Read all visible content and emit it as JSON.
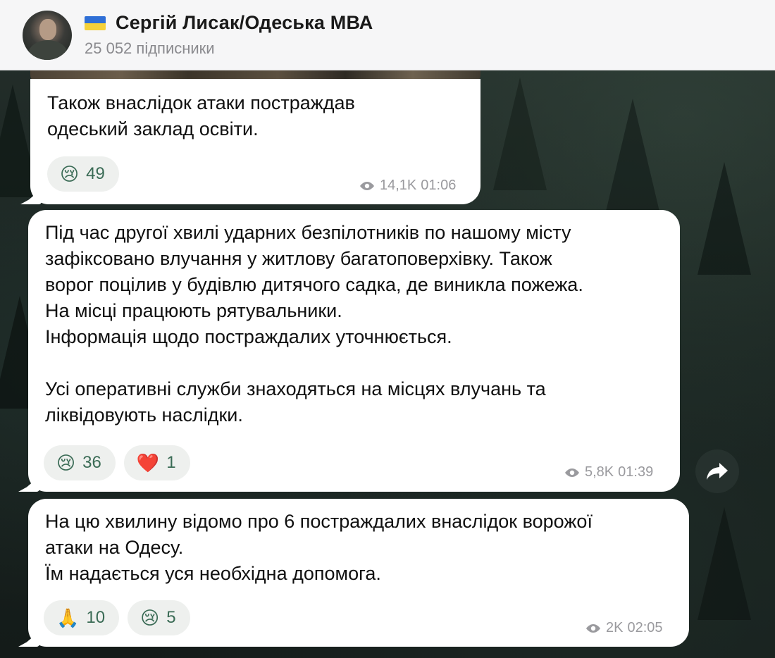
{
  "header": {
    "channel_name": "Сергій Лисак/Одеська МВА",
    "subscribers": "25 052 підписники"
  },
  "messages": [
    {
      "text": "Також внаслідок атаки постраждав\nодеський заклад освіти.",
      "reactions": [
        {
          "emoji": "😢",
          "count": "49",
          "icon": "crying-face-icon"
        }
      ],
      "views": "14,1K",
      "time": "01:06"
    },
    {
      "text": "Під час другої хвилі ударних безпілотників по нашому місту\nзафіксовано влучання у житлову багатоповерхівку. Також\nворог поцілив у будівлю дитячого садка, де виникла пожежа.\nНа місці працюють рятувальники.\nІнформація щодо постраждалих уточнюється.\n\nУсі оперативні служби знаходяться на місцях влучань та\nліквідовують наслідки.",
      "reactions": [
        {
          "emoji": "😢",
          "count": "36",
          "icon": "crying-face-icon"
        },
        {
          "emoji": "❤️",
          "count": "1",
          "icon": "heart-icon"
        }
      ],
      "views": "5,8K",
      "time": "01:39"
    },
    {
      "text": "На цю хвилину відомо про 6 постраждалих внаслідок ворожої\nатаки на Одесу.\nЇм надається уся необхідна допомога.",
      "reactions": [
        {
          "emoji": "🙏",
          "count": "10",
          "icon": "praying-hands-icon"
        },
        {
          "emoji": "😢",
          "count": "5",
          "icon": "crying-face-icon"
        }
      ],
      "views": "2K",
      "time": "02:05"
    }
  ],
  "icons": {
    "views": "eye-icon",
    "share": "share-arrow-icon",
    "flag": "ukraine-flag-icon"
  },
  "colors": {
    "reaction_count": "#3a6b55",
    "meta": "#9a9a9e",
    "bubble": "#ffffff"
  }
}
